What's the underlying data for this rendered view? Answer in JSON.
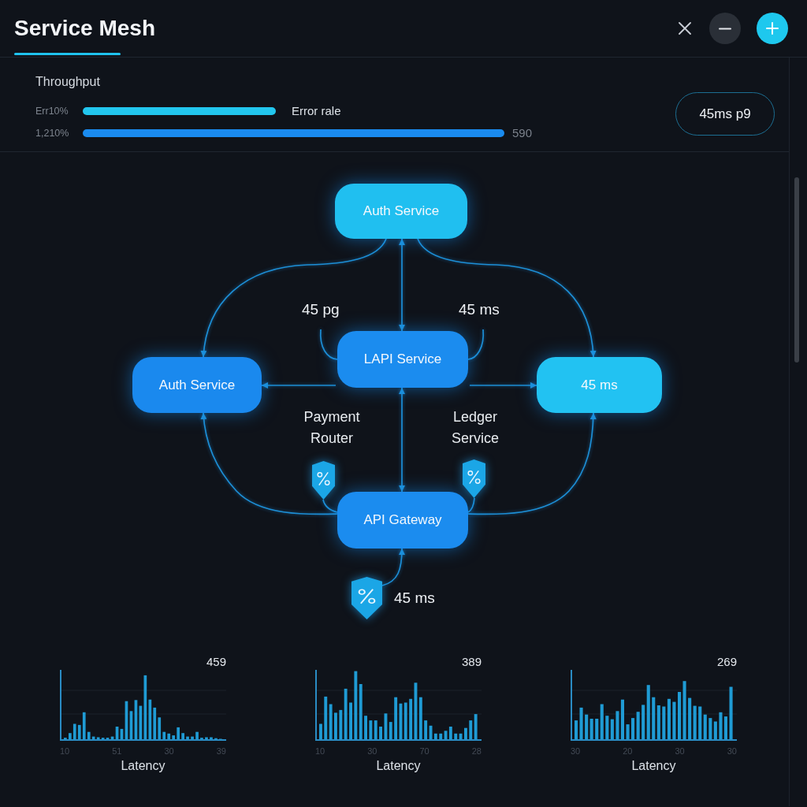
{
  "window": {
    "title": "Service Mesh"
  },
  "metrics": {
    "title": "Throughput",
    "rows": [
      {
        "label": "Err10%",
        "color": "#22c6ee",
        "note": "Error rale",
        "note_muted": false
      },
      {
        "label": "1,210%",
        "color": "#1a8bef",
        "note": "590",
        "note_muted": true
      }
    ],
    "pill": "45ms p9"
  },
  "diagram": {
    "nodes": [
      {
        "label": "Auth Service",
        "color": "#20bff0"
      },
      {
        "label": "LAPI Service",
        "color": "#1b8cef"
      },
      {
        "label": "Auth Service",
        "color": "#1a89ee"
      },
      {
        "label": "45 ms",
        "color": "#22c2f2"
      },
      {
        "label": "API Gateway",
        "color": "#1b8cef"
      }
    ],
    "labels": [
      "45 pg",
      "45 ms",
      "Payment Router",
      "Ledger Service",
      "45 ms"
    ]
  },
  "histograms": [
    {
      "value": "459",
      "ticks": [
        "10",
        "51",
        "30",
        "39"
      ],
      "xlabel": "Latency"
    },
    {
      "value": "389",
      "ticks": [
        "10",
        "30",
        "70",
        "28"
      ],
      "xlabel": "Latency"
    },
    {
      "value": "269",
      "ticks": [
        "30",
        "20",
        "30",
        "30"
      ],
      "xlabel": "Latency"
    }
  ]
}
